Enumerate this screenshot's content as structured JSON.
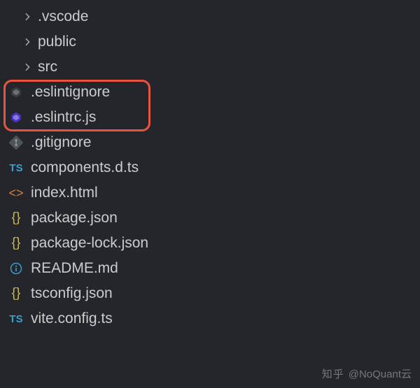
{
  "folders": [
    {
      "name": ".vscode"
    },
    {
      "name": "public"
    },
    {
      "name": "src"
    }
  ],
  "files": [
    {
      "name": ".eslintignore",
      "icon": "eslint-gray"
    },
    {
      "name": ".eslintrc.js",
      "icon": "eslint-purple"
    },
    {
      "name": ".gitignore",
      "icon": "git"
    },
    {
      "name": "components.d.ts",
      "icon": "ts"
    },
    {
      "name": "index.html",
      "icon": "html"
    },
    {
      "name": "package.json",
      "icon": "json"
    },
    {
      "name": "package-lock.json",
      "icon": "json"
    },
    {
      "name": "README.md",
      "icon": "info"
    },
    {
      "name": "tsconfig.json",
      "icon": "json"
    },
    {
      "name": "vite.config.ts",
      "icon": "ts"
    }
  ],
  "watermark": {
    "brand": "知乎",
    "handle": "@NoQuant云"
  },
  "highlight": {
    "start": ".eslintignore",
    "end": ".eslintrc.js",
    "color": "#e8543f"
  }
}
